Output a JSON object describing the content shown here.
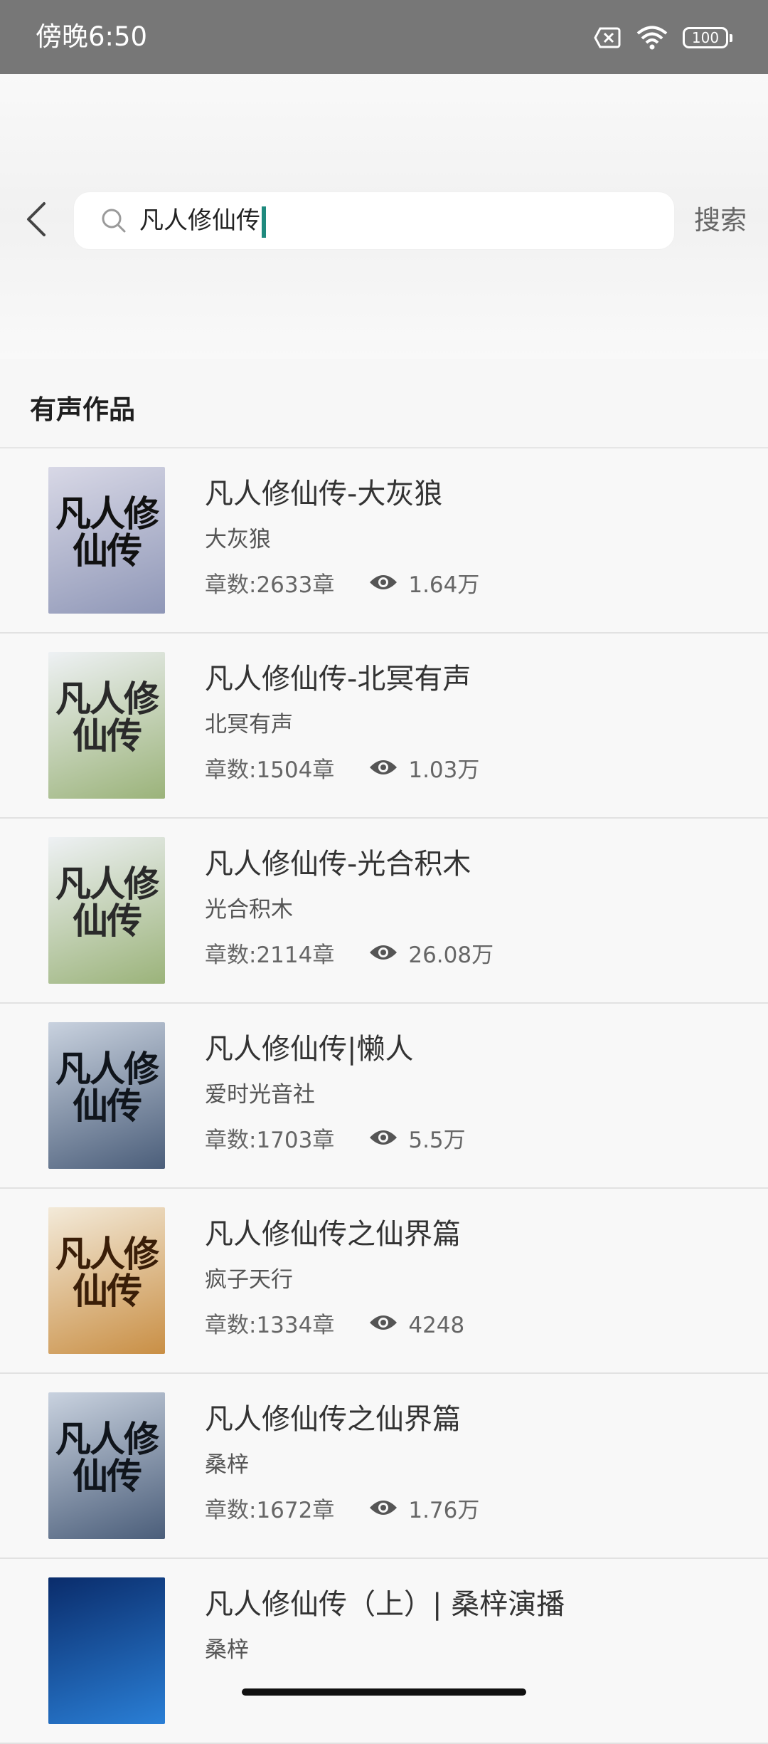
{
  "status_bar": {
    "time": "傍晚6:50",
    "battery": "100"
  },
  "search": {
    "query": "凡人修仙传",
    "button_label": "搜索"
  },
  "section": {
    "title": "有声作品"
  },
  "results": [
    {
      "title": "凡人修仙传-大灰狼",
      "author": "大灰狼",
      "chapters": "章数:2633章",
      "plays": "1.64万",
      "cover_text": "凡人修仙传",
      "cover_colors": [
        "#d8d8e6",
        "#8f97b7"
      ],
      "cover_ink": "#111"
    },
    {
      "title": "凡人修仙传-北冥有声",
      "author": "北冥有声",
      "chapters": "章数:1504章",
      "plays": "1.03万",
      "cover_text": "凡人修仙传",
      "cover_colors": [
        "#eef1f4",
        "#9bb37a"
      ],
      "cover_ink": "#2a2a2a"
    },
    {
      "title": "凡人修仙传-光合积木",
      "author": "光合积木",
      "chapters": "章数:2114章",
      "plays": "26.08万",
      "cover_text": "凡人修仙传",
      "cover_colors": [
        "#eef1f4",
        "#9bb37a"
      ],
      "cover_ink": "#2a2a2a"
    },
    {
      "title": "凡人修仙传|懒人",
      "author": "爱时光音社",
      "chapters": "章数:1703章",
      "plays": "5.5万",
      "cover_text": "凡人修仙传",
      "cover_colors": [
        "#c9d2df",
        "#4b5e7a"
      ],
      "cover_ink": "#10151c"
    },
    {
      "title": "凡人修仙传之仙界篇",
      "author": "疯子天行",
      "chapters": "章数:1334章",
      "plays": "4248",
      "cover_text": "凡人修仙传",
      "cover_colors": [
        "#f3ead9",
        "#c98f45"
      ],
      "cover_ink": "#3a1e08"
    },
    {
      "title": "凡人修仙传之仙界篇",
      "author": "桑梓",
      "chapters": "章数:1672章",
      "plays": "1.76万",
      "cover_text": "凡人修仙传",
      "cover_colors": [
        "#c9d2df",
        "#4b5e7a"
      ],
      "cover_ink": "#10151c"
    },
    {
      "title": "凡人修仙传（上）| 桑梓演播",
      "author": "桑梓",
      "chapters": "",
      "plays": "",
      "cover_text": "",
      "cover_colors": [
        "#0a2c6b",
        "#2a7fd6"
      ],
      "cover_ink": "#ffffff"
    }
  ]
}
